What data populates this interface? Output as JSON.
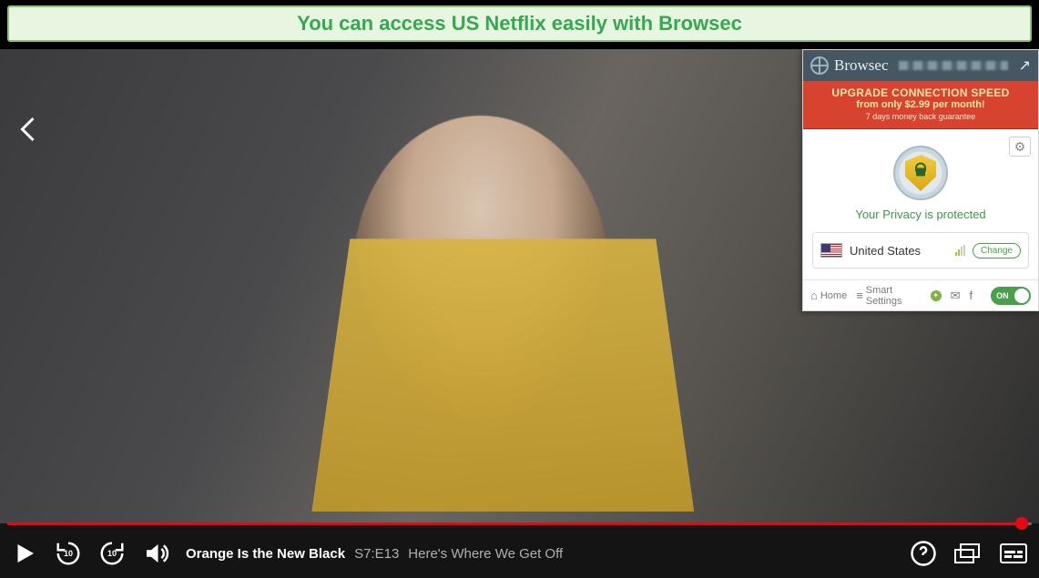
{
  "caption": "You can access US Netflix easily with Browsec",
  "player": {
    "title": "Orange Is the New Black",
    "episode_code": "S7:E13",
    "episode_title": "Here's Where We Get Off",
    "progress_percent": 99,
    "skip_back_seconds": "10",
    "skip_fwd_seconds": "10"
  },
  "browsec": {
    "brand": "Browsec",
    "upgrade": {
      "line1": "UPGRADE CONNECTION SPEED",
      "line2": "from only $2.99 per month!",
      "line3": "7 days money back guarantee"
    },
    "privacy_status": "Your Privacy is protected",
    "location": {
      "country": "United States",
      "change_label": "Change"
    },
    "footer": {
      "home": "Home",
      "smart": "Smart Settings",
      "toggle_label": "ON"
    }
  }
}
